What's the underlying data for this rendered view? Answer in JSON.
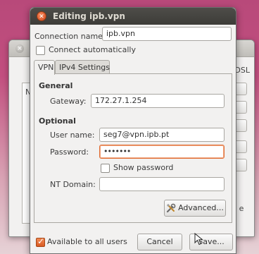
{
  "background_window": {
    "tab_partial": "DSL",
    "list_partial": "Na",
    "button_partial": "e"
  },
  "dialog": {
    "title": "Editing ipb.vpn",
    "connection_name_label": "Connection name:",
    "connection_name_value": "ipb.vpn",
    "connect_automatically_label": "Connect automatically",
    "connect_automatically_checked": false,
    "tabs": [
      {
        "label": "VPN",
        "active": true
      },
      {
        "label": "IPv4 Settings",
        "active": false
      }
    ],
    "vpn": {
      "general_heading": "General",
      "gateway_label": "Gateway:",
      "gateway_value": "172.27.1.254",
      "optional_heading": "Optional",
      "username_label": "User name:",
      "username_value": "seg7@vpn.ipb.pt",
      "password_label": "Password:",
      "password_value": "•••••••",
      "show_password_label": "Show password",
      "show_password_checked": false,
      "nt_domain_label": "NT Domain:",
      "nt_domain_value": "",
      "advanced_button": "Advanced..."
    },
    "available_all_users_label": "Available to all users",
    "available_all_users_checked": true,
    "cancel_button": "Cancel",
    "save_button": "Save..."
  },
  "colors": {
    "accent": "#e0713a",
    "titlebar": "#3d3c38",
    "window_bg": "#f2f1f0"
  }
}
